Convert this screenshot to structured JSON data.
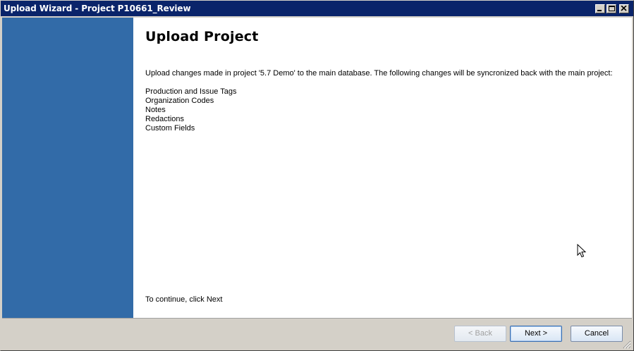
{
  "window": {
    "title": "Upload Wizard - Project P10661_Review"
  },
  "wizard": {
    "heading": "Upload Project",
    "description": "Upload changes made in project '5.7 Demo' to the main database.  The following changes will be syncronized back with the main project:",
    "changes": [
      "Production and Issue Tags",
      "Organization Codes",
      "Notes",
      "Redactions",
      "Custom Fields"
    ],
    "continue_text": "To continue, click Next"
  },
  "buttons": {
    "back_label": "< Back",
    "next_label": "Next >",
    "cancel_label": "Cancel"
  },
  "colors": {
    "titlebar": "#0a246a",
    "side_panel": "#326ba8",
    "background": "#d4d0c8"
  }
}
